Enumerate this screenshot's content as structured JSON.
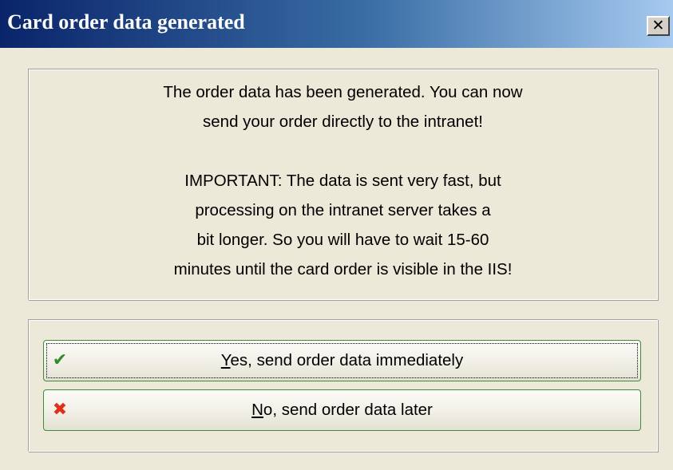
{
  "window": {
    "title": "Card order data generated",
    "close_label": "✕"
  },
  "message": {
    "lines": [
      "The order data has been generated. You can now",
      "send your order directly to the intranet!",
      "",
      "IMPORTANT: The data is sent very fast, but",
      "processing on the intranet server takes a",
      "bit longer. So you will have to wait 15-60",
      "minutes until the card order is visible in the IIS!"
    ]
  },
  "buttons": {
    "yes": {
      "mnemonic": "Y",
      "rest": "es, send order data immediately",
      "icon": "checkmark-icon"
    },
    "no": {
      "mnemonic": "N",
      "rest": "o, send order data later",
      "icon": "cross-icon"
    }
  },
  "colors": {
    "title_gradient_start": "#0a246a",
    "title_gradient_end": "#a6caf0",
    "dialog_background": "#ece9d8",
    "button_border": "#3c8c3c",
    "check_color": "#2e8b2e",
    "cross_color": "#e0301c"
  }
}
